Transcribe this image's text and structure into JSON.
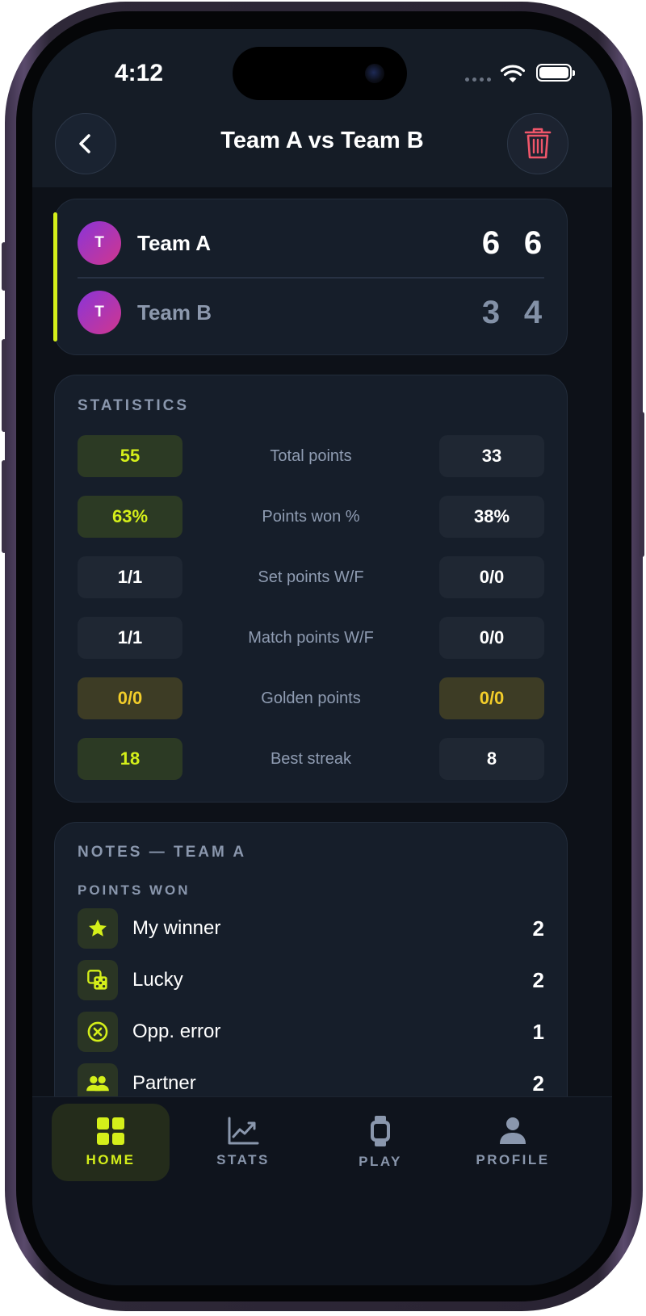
{
  "status_bar": {
    "time": "4:12"
  },
  "header": {
    "title": "Team A vs Team B"
  },
  "score": {
    "teams": [
      {
        "initial": "T",
        "name": "Team A",
        "sets": [
          "6",
          "6"
        ]
      },
      {
        "initial": "T",
        "name": "Team B",
        "sets": [
          "3",
          "4"
        ]
      }
    ]
  },
  "statistics": {
    "title": "STATISTICS",
    "rows": [
      {
        "label": "Total points",
        "left": "55",
        "right": "33"
      },
      {
        "label": "Points won %",
        "left": "63%",
        "right": "38%"
      },
      {
        "label": "Set points W/F",
        "left": "1/1",
        "right": "0/0"
      },
      {
        "label": "Match points W/F",
        "left": "1/1",
        "right": "0/0"
      },
      {
        "label": "Golden points",
        "left": "0/0",
        "right": "0/0"
      },
      {
        "label": "Best streak",
        "left": "18",
        "right": "8"
      }
    ]
  },
  "notes": {
    "title": "NOTES — TEAM A",
    "subtitle": "POINTS WON",
    "items": [
      {
        "label": "My winner",
        "count": "2",
        "icon": "star-icon"
      },
      {
        "label": "Lucky",
        "count": "2",
        "icon": "dice-icon"
      },
      {
        "label": "Opp. error",
        "count": "1",
        "icon": "circle-x-icon"
      },
      {
        "label": "Partner",
        "count": "2",
        "icon": "people-icon"
      }
    ]
  },
  "tabs": [
    {
      "label": "HOME",
      "icon": "grid-icon",
      "active": true
    },
    {
      "label": "STATS",
      "icon": "chart-icon",
      "active": false
    },
    {
      "label": "PLAY",
      "icon": "watch-icon",
      "active": false
    },
    {
      "label": "PROFILE",
      "icon": "person-icon",
      "active": false
    }
  ],
  "colors": {
    "accent": "#d4ef1a",
    "gold": "#f2cd2a",
    "danger": "#f0566a",
    "background": "#0d1118",
    "card": "#161e2a"
  }
}
